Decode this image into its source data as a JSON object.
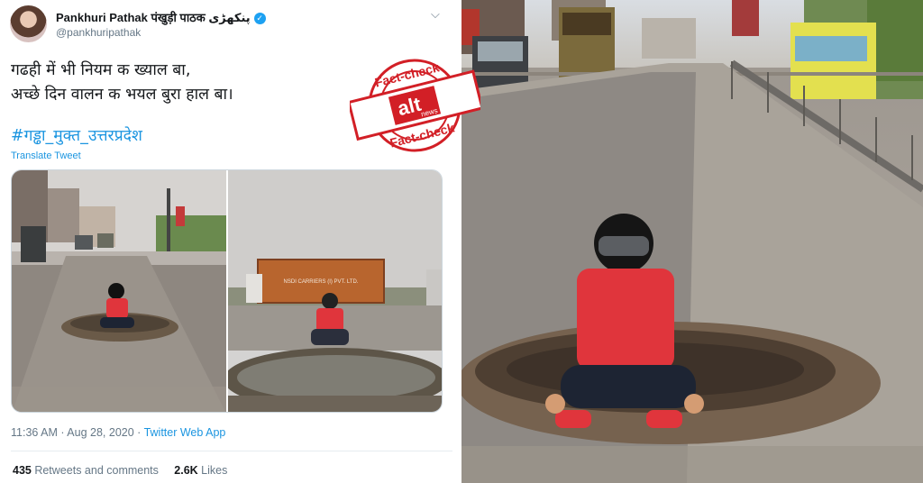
{
  "tweet": {
    "display_name": "Pankhuri Pathak पंखुड़ी पाठक پنکھڑی",
    "handle": "@pankhuripathak",
    "text_line1": "गढही में भी नियम क ख्याल बा,",
    "text_line2": "अच्छे दिन वालन क भयल बुरा हाल बा।",
    "hashtag": "#गड्ढा_मुक्त_उत्तरप्रदेश",
    "translate": "Translate Tweet",
    "timestamp": "11:36 AM · Aug 28, 2020 · ",
    "source": "Twitter Web App",
    "retweets_count": "435",
    "retweets_label": " Retweets and comments",
    "likes_count": "2.6K",
    "likes_label": " Likes"
  },
  "stamp": {
    "top_text": "Fact-check",
    "bottom_text": "Fact-check",
    "logo_word": "alt",
    "logo_sub": "news"
  },
  "photo_left": {
    "truck_text": "NSDI CARRIERS (I) PVT. LTD."
  },
  "colors": {
    "link": "#1b95e0",
    "stamp_red": "#d21f26",
    "shirt": "#e0353c"
  },
  "icons": [
    "verified-icon",
    "chevron-down-icon"
  ]
}
